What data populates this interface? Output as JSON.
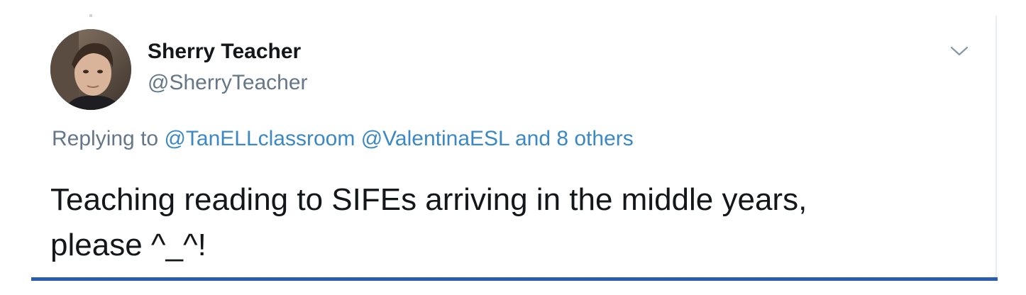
{
  "tweet": {
    "author": {
      "display_name": "Sherry Teacher",
      "handle": "@SherryTeacher"
    },
    "reply_context": {
      "prefix": "Replying to",
      "mentions": [
        "@TanELLclassroom",
        "@ValentinaESL"
      ],
      "others_text": "and 8 others"
    },
    "text_line1": "Teaching reading to SIFEs arriving in the middle years,",
    "text_line2": "please ^_^!",
    "menu_icon": "chevron-down-icon"
  },
  "colors": {
    "text_primary": "#14171a",
    "text_secondary": "#657786",
    "link": "#3b88c3",
    "accent_bar": "#2a5db0"
  }
}
